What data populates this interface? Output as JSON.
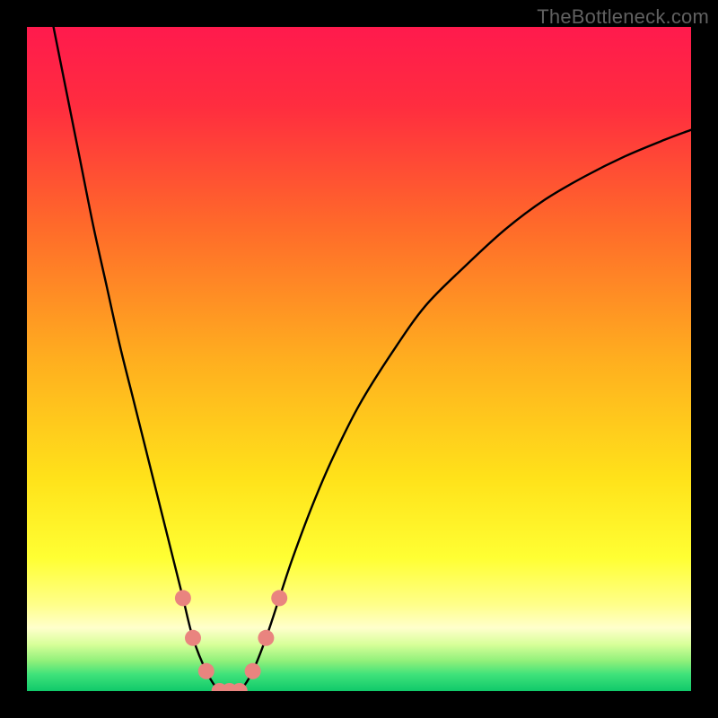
{
  "watermark": "TheBottleneck.com",
  "chart_data": {
    "type": "line",
    "title": "",
    "xlabel": "",
    "ylabel": "",
    "xlim": [
      0,
      100
    ],
    "ylim": [
      0,
      100
    ],
    "grid": false,
    "background_gradient": {
      "stops": [
        {
          "offset": 0.0,
          "color": "#ff1a4d"
        },
        {
          "offset": 0.12,
          "color": "#ff2d3f"
        },
        {
          "offset": 0.3,
          "color": "#ff6a2a"
        },
        {
          "offset": 0.5,
          "color": "#ffae1f"
        },
        {
          "offset": 0.68,
          "color": "#ffe21a"
        },
        {
          "offset": 0.8,
          "color": "#ffff33"
        },
        {
          "offset": 0.87,
          "color": "#ffff8a"
        },
        {
          "offset": 0.905,
          "color": "#ffffcc"
        },
        {
          "offset": 0.93,
          "color": "#d7ff99"
        },
        {
          "offset": 0.955,
          "color": "#8ff07a"
        },
        {
          "offset": 0.975,
          "color": "#3fe27a"
        },
        {
          "offset": 1.0,
          "color": "#10c96a"
        }
      ]
    },
    "series": [
      {
        "name": "curve",
        "color": "#000000",
        "x": [
          4,
          6,
          8,
          10,
          12,
          14,
          16,
          18,
          20,
          22,
          23.5,
          25,
          27,
          29,
          30.5,
          32,
          34,
          36,
          38,
          40,
          43,
          46,
          50,
          55,
          60,
          66,
          72,
          78,
          84,
          90,
          96,
          100
        ],
        "y": [
          100,
          90,
          80,
          70,
          61,
          52,
          44,
          36,
          28,
          20,
          14,
          8,
          3,
          0,
          0,
          0,
          3,
          8,
          14,
          20,
          28,
          35,
          43,
          51,
          58,
          64,
          69.5,
          74,
          77.5,
          80.5,
          83,
          84.5
        ]
      }
    ],
    "markers": {
      "name": "highlight-points",
      "color": "#e9847f",
      "radius_px": 9,
      "points": [
        {
          "x": 23.5,
          "y": 14
        },
        {
          "x": 25.0,
          "y": 8
        },
        {
          "x": 27.0,
          "y": 3
        },
        {
          "x": 29.0,
          "y": 0
        },
        {
          "x": 30.5,
          "y": 0
        },
        {
          "x": 32.0,
          "y": 0
        },
        {
          "x": 34.0,
          "y": 3
        },
        {
          "x": 36.0,
          "y": 8
        },
        {
          "x": 38.0,
          "y": 14
        }
      ]
    }
  }
}
